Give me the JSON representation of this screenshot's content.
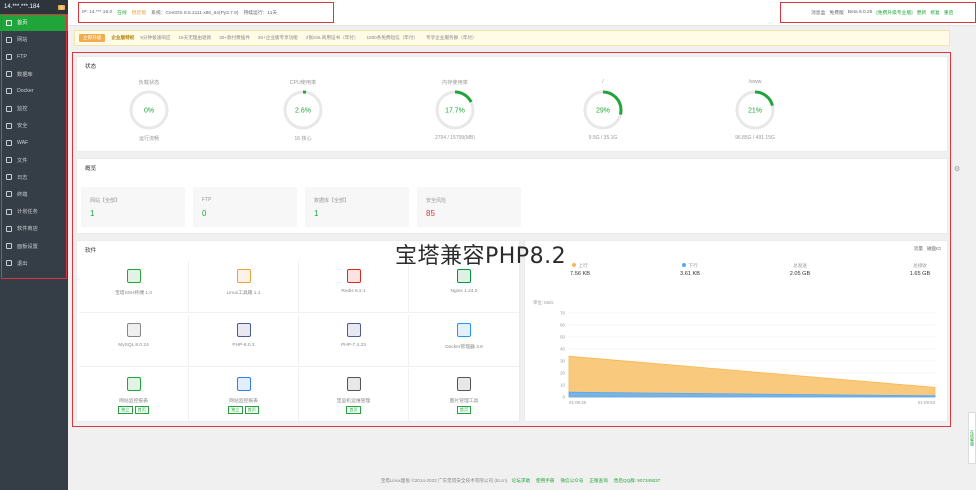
{
  "sidebar": {
    "ip": "14.***.***.184",
    "badge": "0",
    "items": [
      {
        "label": "首页",
        "icon": "home-icon"
      },
      {
        "label": "网站",
        "icon": "globe-icon"
      },
      {
        "label": "FTP",
        "icon": "ftp-icon"
      },
      {
        "label": "数据库",
        "icon": "database-icon"
      },
      {
        "label": "Docker",
        "icon": "docker-icon"
      },
      {
        "label": "监控",
        "icon": "monitor-icon"
      },
      {
        "label": "安全",
        "icon": "shield-icon"
      },
      {
        "label": "WAF",
        "icon": "waf-icon"
      },
      {
        "label": "文件",
        "icon": "folder-icon"
      },
      {
        "label": "日志",
        "icon": "log-icon"
      },
      {
        "label": "终端",
        "icon": "terminal-icon"
      },
      {
        "label": "计划任务",
        "icon": "clock-icon"
      },
      {
        "label": "软件商店",
        "icon": "store-icon"
      },
      {
        "label": "面板设置",
        "icon": "settings-icon"
      },
      {
        "label": "退出",
        "icon": "logout-icon"
      }
    ]
  },
  "topbar": {
    "ip_text": "IP: 14.***.16.0",
    "status": "在线",
    "tag": "稳定版",
    "system": "系统：CentOS 8.5.2111 x86_64(Py3.7.9)",
    "uptime": "持续运行：11天",
    "right_message": "消息盒",
    "version_label": "免费版",
    "version": "Beta 8.0.25",
    "upgrade": "[免费升级专业版]",
    "update": "更新",
    "fix": "修复",
    "restart": "重启"
  },
  "promo": {
    "button": "立即升级",
    "enterprise": "企业版特权",
    "items": [
      "5分钟极速响应",
      "15天无理由退款",
      "30+款付费插件",
      "20+企业版专享功能",
      "2张SSL商用证书（年付）",
      "1000条免费短信（年付）",
      "专享企业服务群（年付）"
    ]
  },
  "status": {
    "title": "状态",
    "gauges": [
      {
        "label": "负载状态",
        "value": "0%",
        "percent": 0,
        "sub": "运行流畅"
      },
      {
        "label": "CPU使用率",
        "value": "2.6%",
        "percent": 2.6,
        "sub": "16 核心"
      },
      {
        "label": "内存使用率",
        "value": "17.7%",
        "percent": 17.7,
        "sub": "2794 / 15799(MB)"
      },
      {
        "label": "/",
        "value": "29%",
        "percent": 29,
        "sub": "9.5G / 35.1G"
      },
      {
        "label": "/www",
        "value": "21%",
        "percent": 21,
        "sub": "96.85G / 491.15G"
      }
    ]
  },
  "overview": {
    "title": "概览",
    "cards": [
      {
        "label": "网站【全部】",
        "value": "1"
      },
      {
        "label": "FTP",
        "value": "0"
      },
      {
        "label": "数据库【全部】",
        "value": "1"
      },
      {
        "label": "安全风险",
        "value": "85",
        "risk": true
      }
    ]
  },
  "software": {
    "title": "软件",
    "items": [
      {
        "name": "宝塔SSH终端 1.0",
        "icon": "terminal-app-icon",
        "color": "#20a53a"
      },
      {
        "name": "Linux工具箱 1.1",
        "icon": "tools-icon",
        "color": "#e6a23c"
      },
      {
        "name": "Redis 6.2.1",
        "icon": "redis-icon",
        "color": "#d82c20"
      },
      {
        "name": "Nginx 1.24.0",
        "icon": "nginx-icon",
        "color": "#009639"
      },
      {
        "name": "MySQL 8.0.24",
        "icon": "mysql-icon",
        "color": "#888888"
      },
      {
        "name": "PHP-8.0.3",
        "icon": "php-icon",
        "color": "#4f5b93"
      },
      {
        "name": "PHP-7.4.33",
        "icon": "php-icon",
        "color": "#4f5b93"
      },
      {
        "name": "Docker管理器 3.8",
        "icon": "docker-whale-icon",
        "color": "#2496ed"
      },
      {
        "name": "网站监控报表",
        "icon": "report-icon",
        "color": "#20a53a",
        "btn": [
          "独立",
          "首页"
        ]
      },
      {
        "name": "网站监控报表",
        "icon": "earth-icon",
        "color": "#2f80ed",
        "btn": [
          "独立",
          "首页"
        ]
      },
      {
        "name": "堡垒机运维管理",
        "icon": "window-icon",
        "color": "#555555",
        "btn": [
          "首页"
        ]
      },
      {
        "name": "图片管理工具",
        "icon": "image-icon",
        "color": "#555555",
        "btn": [
          "首页"
        ]
      }
    ]
  },
  "traffic": {
    "tabs": [
      "流量",
      "磁盘IO"
    ],
    "stats": [
      {
        "label": "上行",
        "value": "7.56 KB",
        "dot": "#f7b851"
      },
      {
        "label": "下行",
        "value": "3.61 KB",
        "dot": "#52a9ff"
      },
      {
        "label": "总发送",
        "value": "2.05 GB"
      },
      {
        "label": "总接收",
        "value": "1.65 GB"
      }
    ],
    "unit": "单位: KB/s",
    "chart_data": {
      "type": "area",
      "x": [
        "01:09:45",
        "01:09:53"
      ],
      "series": [
        {
          "name": "上行",
          "values": [
            34,
            8
          ],
          "color": "#f7b851"
        },
        {
          "name": "下行",
          "values": [
            4,
            1
          ],
          "color": "#52a9ff"
        }
      ],
      "ylim": [
        0,
        70
      ],
      "yticks": [
        0,
        10,
        20,
        30,
        40,
        50,
        60,
        70
      ],
      "grid": true
    }
  },
  "watermark": "宝塔兼容PHP8.2",
  "footer": {
    "copyright": "宝塔Linux面板 ©2014-2023 广东堡塔安全技术有限公司 (bt.cn)",
    "links": [
      "论坛求助",
      "使用手册",
      "微信公众号",
      "正版查询",
      "售后QQ群: 907345037"
    ]
  },
  "right_tab": "在线客服"
}
